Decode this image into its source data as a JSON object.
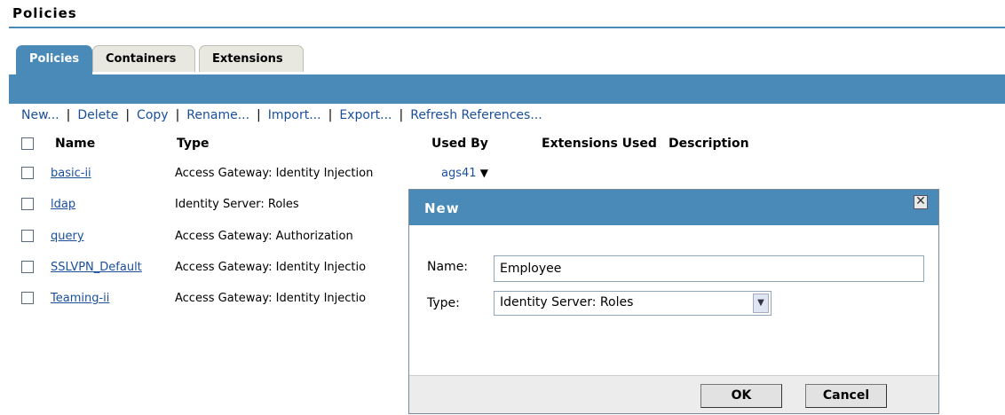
{
  "page": {
    "title": "Policies"
  },
  "tabs": [
    {
      "label": "Policies",
      "active": true
    },
    {
      "label": "Containers",
      "active": false
    },
    {
      "label": "Extensions",
      "active": false
    }
  ],
  "actions": [
    "New...",
    "Delete",
    "Copy",
    "Rename...",
    "Import...",
    "Export...",
    "Refresh References..."
  ],
  "table": {
    "headers": {
      "name": "Name",
      "type": "Type",
      "used_by": "Used By",
      "extensions": "Extensions Used",
      "description": "Description"
    },
    "rows": [
      {
        "name": "basic-ii",
        "type": "Access Gateway: Identity Injection",
        "used_by": "ags41"
      },
      {
        "name": "ldap",
        "type": "Identity Server: Roles",
        "used_by": ""
      },
      {
        "name": "query",
        "type": "Access Gateway: Authorization",
        "used_by": ""
      },
      {
        "name": "SSLVPN_Default",
        "type": "Access Gateway: Identity Injectio",
        "used_by": ""
      },
      {
        "name": "Teaming-ii",
        "type": "Access Gateway: Identity Injectio",
        "used_by": ""
      }
    ]
  },
  "dialog": {
    "title": "New",
    "name_label": "Name:",
    "name_value": "Employee",
    "type_label": "Type:",
    "type_value": "Identity Server: Roles",
    "ok_label": "OK",
    "cancel_label": "Cancel"
  },
  "icons": {
    "close": "close-icon",
    "dropdown": "chevron-down-icon",
    "usedby_arrow": "triangle-down-icon"
  },
  "colors": {
    "accent": "#4a8ab8",
    "link": "#1a4f9c"
  }
}
